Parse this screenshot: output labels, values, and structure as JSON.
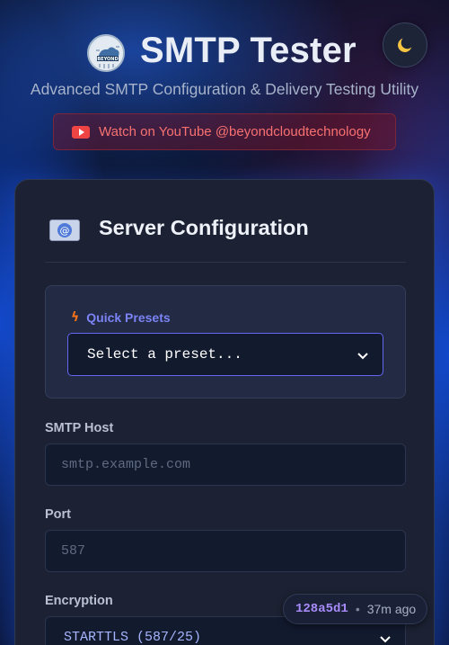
{
  "header": {
    "logo_text": "BEYOND",
    "title": "SMTP Tester",
    "subtitle": "Advanced SMTP Configuration & Delivery Testing Utility",
    "theme_toggle_icon": "moon-icon",
    "youtube_link": "Watch on YouTube @beyondcloudtechnology"
  },
  "card": {
    "title": "Server Configuration",
    "icon": "email-at-icon",
    "presets": {
      "label": "Quick Presets",
      "selected": "Select a preset..."
    },
    "fields": {
      "host_label": "SMTP Host",
      "host_placeholder": "smtp.example.com",
      "port_label": "Port",
      "port_placeholder": "587",
      "encryption_label": "Encryption",
      "encryption_selected": "STARTTLS (587/25)"
    }
  },
  "build": {
    "commit": "128a5d1",
    "separator": "•",
    "age": "37m ago"
  },
  "colors": {
    "accent": "#6366f1",
    "youtube_red": "#ef4444",
    "background": "#0b1226"
  }
}
